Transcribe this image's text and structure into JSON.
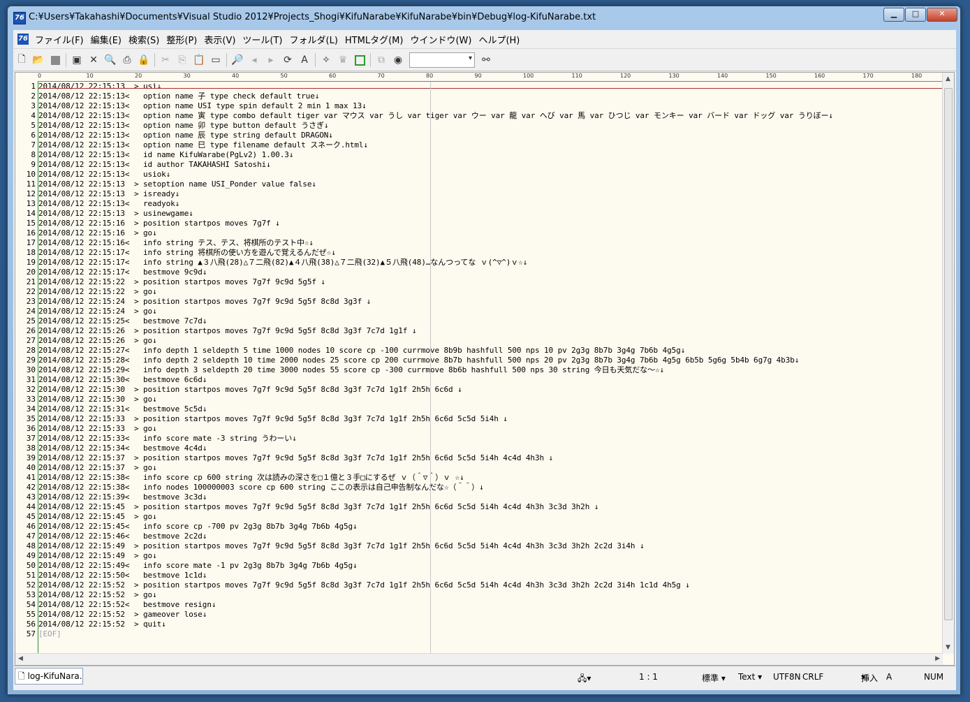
{
  "window": {
    "title": "C:¥Users¥Takahashi¥Documents¥Visual Studio 2012¥Projects_Shogi¥KifuNarabe¥KifuNarabe¥bin¥Debug¥log-KifuNarabe.txt",
    "app_icon": "76",
    "buttons": {
      "minimize": "▁",
      "maximize": "□",
      "close": "✕"
    }
  },
  "menu": [
    "ファイル(F)",
    "編集(E)",
    "検索(S)",
    "整形(P)",
    "表示(V)",
    "ツール(T)",
    "フォルダ(L)",
    "HTMLタグ(M)",
    "ウインドウ(W)",
    "ヘルプ(H)"
  ],
  "toolbar": {
    "icons": [
      "new-file-icon",
      "open-folder-icon",
      "save-icon",
      "save-close-icon",
      "close-x-icon",
      "print-preview-icon",
      "print-icon",
      "lock-icon",
      "cut-icon",
      "copy-icon",
      "paste-icon",
      "select-all-icon",
      "find-icon",
      "find-prev-icon",
      "find-next-icon",
      "replace-icon",
      "spell-check-icon",
      "text-style-icon",
      "tag-icon",
      "box-icon",
      "compare-icon",
      "browser-icon",
      "binoculars-icon"
    ]
  },
  "ruler": [
    "0",
    "10",
    "20",
    "30",
    "40",
    "50",
    "60",
    "70",
    "80",
    "90",
    "100",
    "110",
    "120",
    "130",
    "140",
    "150",
    "160",
    "170",
    "180"
  ],
  "lines": [
    "2014/08/12 22:15:13  > usi↓",
    "2014/08/12 22:15:13<   option name 子 type check default true↓",
    "2014/08/12 22:15:13<   option name USI type spin default 2 min 1 max 13↓",
    "2014/08/12 22:15:13<   option name 寅 type combo default tiger var マウス var うし var tiger var ウー var 龍 var へび var 馬 var ひつじ var モンキー var バード var ドッグ var うりぼー↓",
    "2014/08/12 22:15:13<   option name 卯 type button default うさぎ↓",
    "2014/08/12 22:15:13<   option name 辰 type string default DRAGON↓",
    "2014/08/12 22:15:13<   option name 巳 type filename default スネーク.html↓",
    "2014/08/12 22:15:13<   id name KifuWarabe(PgLv2) 1.00.3↓",
    "2014/08/12 22:15:13<   id author TAKAHASHI Satoshi↓",
    "2014/08/12 22:15:13<   usiok↓",
    "2014/08/12 22:15:13  > setoption name USI_Ponder value false↓",
    "2014/08/12 22:15:13  > isready↓",
    "2014/08/12 22:15:13<   readyok↓",
    "2014/08/12 22:15:13  > usinewgame↓",
    "2014/08/12 22:15:16  > position startpos moves 7g7f ↓",
    "2014/08/12 22:15:16  > go↓",
    "2014/08/12 22:15:16<   info string テス、テス、将棋所のテスト中☆↓",
    "2014/08/12 22:15:17<   info string 将棋所の使い方を遊んで覚えるんだぜ☆↓",
    "2014/08/12 22:15:17<   info string ▲３八飛(28)△７二飛(82)▲４八飛(38)△７二飛(32)▲５八飛(48)…なんつってな ｖ(^▽^)ｖ☆↓",
    "2014/08/12 22:15:17<   bestmove 9c9d↓",
    "2014/08/12 22:15:22  > position startpos moves 7g7f 9c9d 5g5f ↓",
    "2014/08/12 22:15:22  > go↓",
    "2014/08/12 22:15:24  > position startpos moves 7g7f 9c9d 5g5f 8c8d 3g3f ↓",
    "2014/08/12 22:15:24  > go↓",
    "2014/08/12 22:15:25<   bestmove 7c7d↓",
    "2014/08/12 22:15:26  > position startpos moves 7g7f 9c9d 5g5f 8c8d 3g3f 7c7d 1g1f ↓",
    "2014/08/12 22:15:26  > go↓",
    "2014/08/12 22:15:27<   info depth 1 seldepth 5 time 1000 nodes 10 score cp -100 currmove 8b9b hashfull 500 nps 10 pv 2g3g 8b7b 3g4g 7b6b 4g5g↓",
    "2014/08/12 22:15:28<   info depth 2 seldepth 10 time 2000 nodes 25 score cp 200 currmove 8b7b hashfull 500 nps 20 pv 2g3g 8b7b 3g4g 7b6b 4g5g 6b5b 5g6g 5b4b 6g7g 4b3b↓",
    "2014/08/12 22:15:29<   info depth 3 seldepth 20 time 3000 nodes 55 score cp -300 currmove 8b6b hashfull 500 nps 30 string 今日も天気だな～☆↓",
    "2014/08/12 22:15:30<   bestmove 6c6d↓",
    "2014/08/12 22:15:30  > position startpos moves 7g7f 9c9d 5g5f 8c8d 3g3f 7c7d 1g1f 2h5h 6c6d ↓",
    "2014/08/12 22:15:30  > go↓",
    "2014/08/12 22:15:31<   bestmove 5c5d↓",
    "2014/08/12 22:15:33  > position startpos moves 7g7f 9c9d 5g5f 8c8d 3g3f 7c7d 1g1f 2h5h 6c6d 5c5d 5i4h ↓",
    "2014/08/12 22:15:33  > go↓",
    "2014/08/12 22:15:33<   info score mate -3 string うわーい↓",
    "2014/08/12 22:15:34<   bestmove 4c4d↓",
    "2014/08/12 22:15:37  > position startpos moves 7g7f 9c9d 5g5f 8c8d 3g3f 7c7d 1g1f 2h5h 6c6d 5c5d 5i4h 4c4d 4h3h ↓",
    "2014/08/12 22:15:37  > go↓",
    "2014/08/12 22:15:38<   info score cp 600 string 次は読みの深さを□１億と３手□にするぜ ｖ（＾▽＾）ｖ ☆↓",
    "2014/08/12 22:15:38<   info nodes 100000003 score cp 600 string ここの表示は自己申告制なんだな☆（＾＾）↓",
    "2014/08/12 22:15:39<   bestmove 3c3d↓",
    "2014/08/12 22:15:45  > position startpos moves 7g7f 9c9d 5g5f 8c8d 3g3f 7c7d 1g1f 2h5h 6c6d 5c5d 5i4h 4c4d 4h3h 3c3d 3h2h ↓",
    "2014/08/12 22:15:45  > go↓",
    "2014/08/12 22:15:45<   info score cp -700 pv 2g3g 8b7b 3g4g 7b6b 4g5g↓",
    "2014/08/12 22:15:46<   bestmove 2c2d↓",
    "2014/08/12 22:15:49  > position startpos moves 7g7f 9c9d 5g5f 8c8d 3g3f 7c7d 1g1f 2h5h 6c6d 5c5d 5i4h 4c4d 4h3h 3c3d 3h2h 2c2d 3i4h ↓",
    "2014/08/12 22:15:49  > go↓",
    "2014/08/12 22:15:49<   info score mate -1 pv 2g3g 8b7b 3g4g 7b6b 4g5g↓",
    "2014/08/12 22:15:50<   bestmove 1c1d↓",
    "2014/08/12 22:15:52  > position startpos moves 7g7f 9c9d 5g5f 8c8d 3g3f 7c7d 1g1f 2h5h 6c6d 5c5d 5i4h 4c4d 4h3h 3c3d 3h2h 2c2d 3i4h 1c1d 4h5g ↓",
    "2014/08/12 22:15:52  > go↓",
    "2014/08/12 22:15:52<   bestmove resign↓",
    "2014/08/12 22:15:52  > gameover lose↓",
    "2014/08/12 22:15:52  > quit↓",
    "[EOF]"
  ],
  "tab": {
    "label": "log-KifuNara..."
  },
  "status": {
    "position": "1 : 1",
    "style": "標準",
    "mode": "Text",
    "encoding": "UTF8N",
    "eol": "CRLF",
    "insert": "挿入",
    "ime": "A",
    "numlock": "NUM"
  }
}
